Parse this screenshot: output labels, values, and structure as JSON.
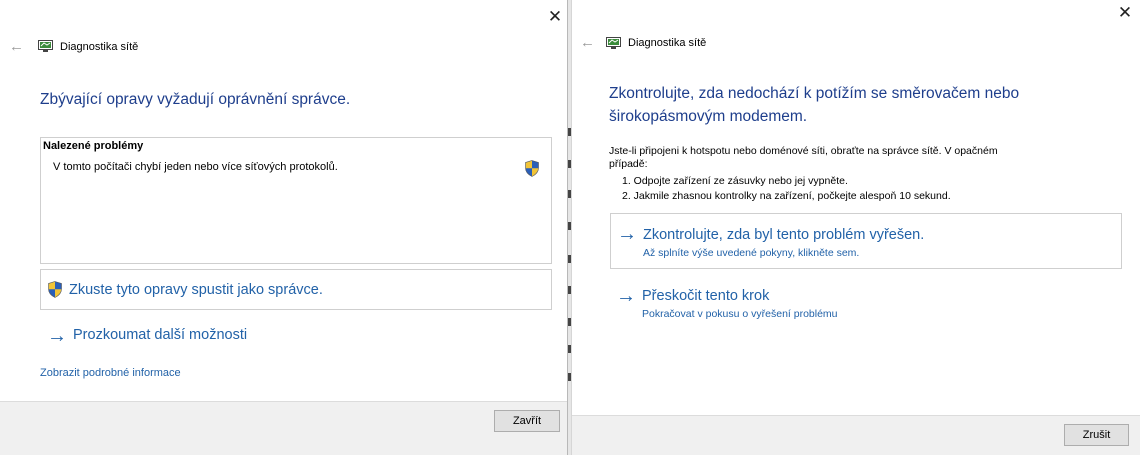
{
  "left_window": {
    "title": "Diagnostika sítě",
    "heading": "Zbývající opravy vyžadují oprávnění správce.",
    "problems_box": {
      "title": "Nalezené problémy",
      "items": [
        "V tomto počítači chybí jeden nebo více síťových protokolů."
      ]
    },
    "run_as_admin_label": "Zkuste tyto opravy spustit jako správce.",
    "explore_label": "Prozkoumat další možnosti",
    "details_link": "Zobrazit podrobné informace",
    "close_button": "Zavřít"
  },
  "right_window": {
    "title": "Diagnostika sítě",
    "heading_line1": "Zkontrolujte, zda nedochází k potížím se směrovačem nebo",
    "heading_line2": "širokopásmovým modemem.",
    "paragraph_line1": "Jste-li připojeni k hotspotu nebo doménové síti, obraťte na správce sítě. V opačném",
    "paragraph_line2": "případě:",
    "steps": [
      "1. Odpojte zařízení ze zásuvky nebo jej vypněte.",
      "2. Jakmile zhasnou kontrolky na zařízení, počkejte alespoň 10 sekund."
    ],
    "option_check": {
      "title": "Zkontrolujte, zda byl tento problém vyřešen.",
      "subtitle": "Až splníte výše uvedené pokyny, klikněte sem."
    },
    "option_skip": {
      "title": "Přeskočit tento krok",
      "subtitle": "Pokračovat v pokusu o vyřešení problému"
    },
    "cancel_button": "Zrušit"
  },
  "icons": {
    "close": "close-icon",
    "back": "back-arrow-icon",
    "app": "network-diagnostics-icon",
    "shield": "uac-shield-icon",
    "arrow": "arrow-right-icon"
  },
  "colors": {
    "heading": "#1e3e8c",
    "link": "#2262a8",
    "footer_bg": "#f0f0f0"
  }
}
